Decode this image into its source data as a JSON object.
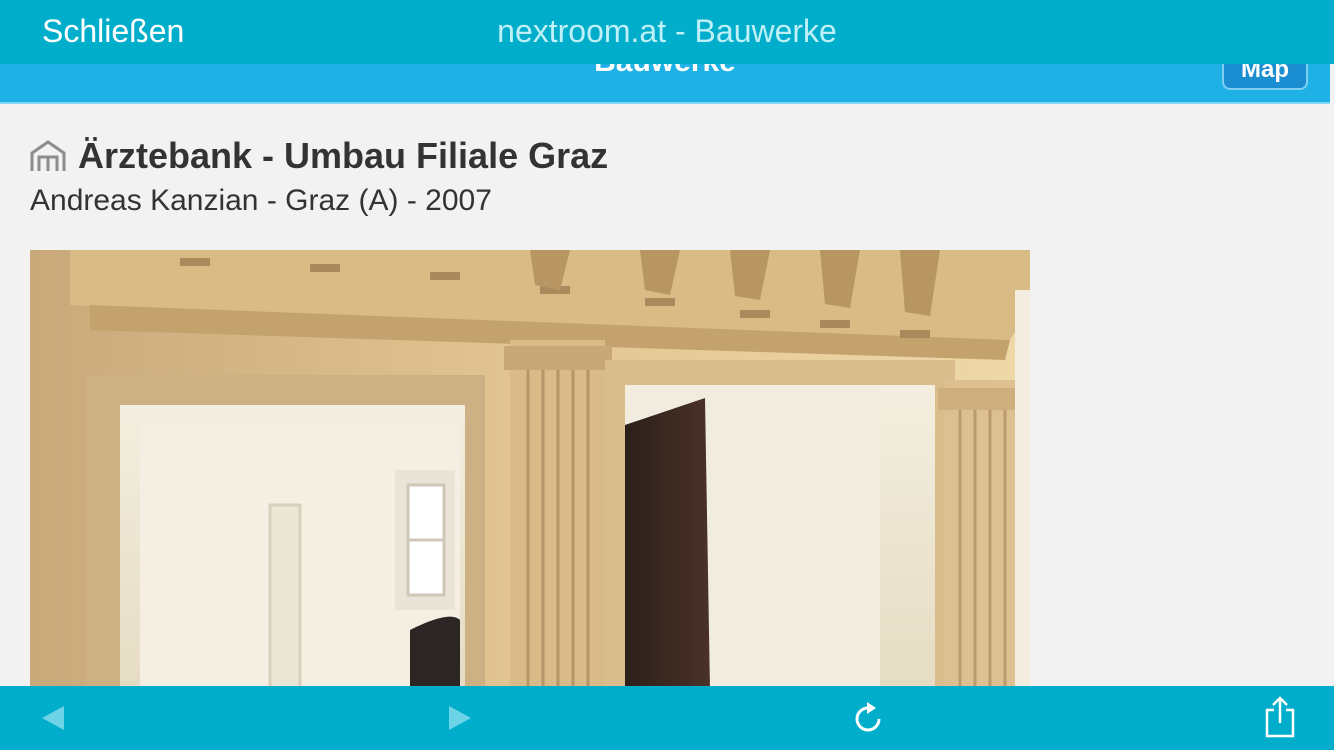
{
  "topbar": {
    "close_label": "Schließen",
    "title": "nextroom.at - Bauwerke"
  },
  "site_header": {
    "title": "Bauwerke",
    "map_label": "Map"
  },
  "article": {
    "icon": "building-icon",
    "title": "Ärztebank - Umbau Filiale Graz",
    "subtitle": "Andreas Kanzian - Graz (A) - 2007"
  },
  "toolbar": {
    "back_icon": "back-arrow-icon",
    "forward_icon": "forward-arrow-icon",
    "reload_icon": "reload-icon",
    "share_icon": "share-icon"
  },
  "colors": {
    "bar": "#00aecc",
    "site_header": "#1fb0e6",
    "text": "#333333",
    "background": "#f2f2f2"
  }
}
